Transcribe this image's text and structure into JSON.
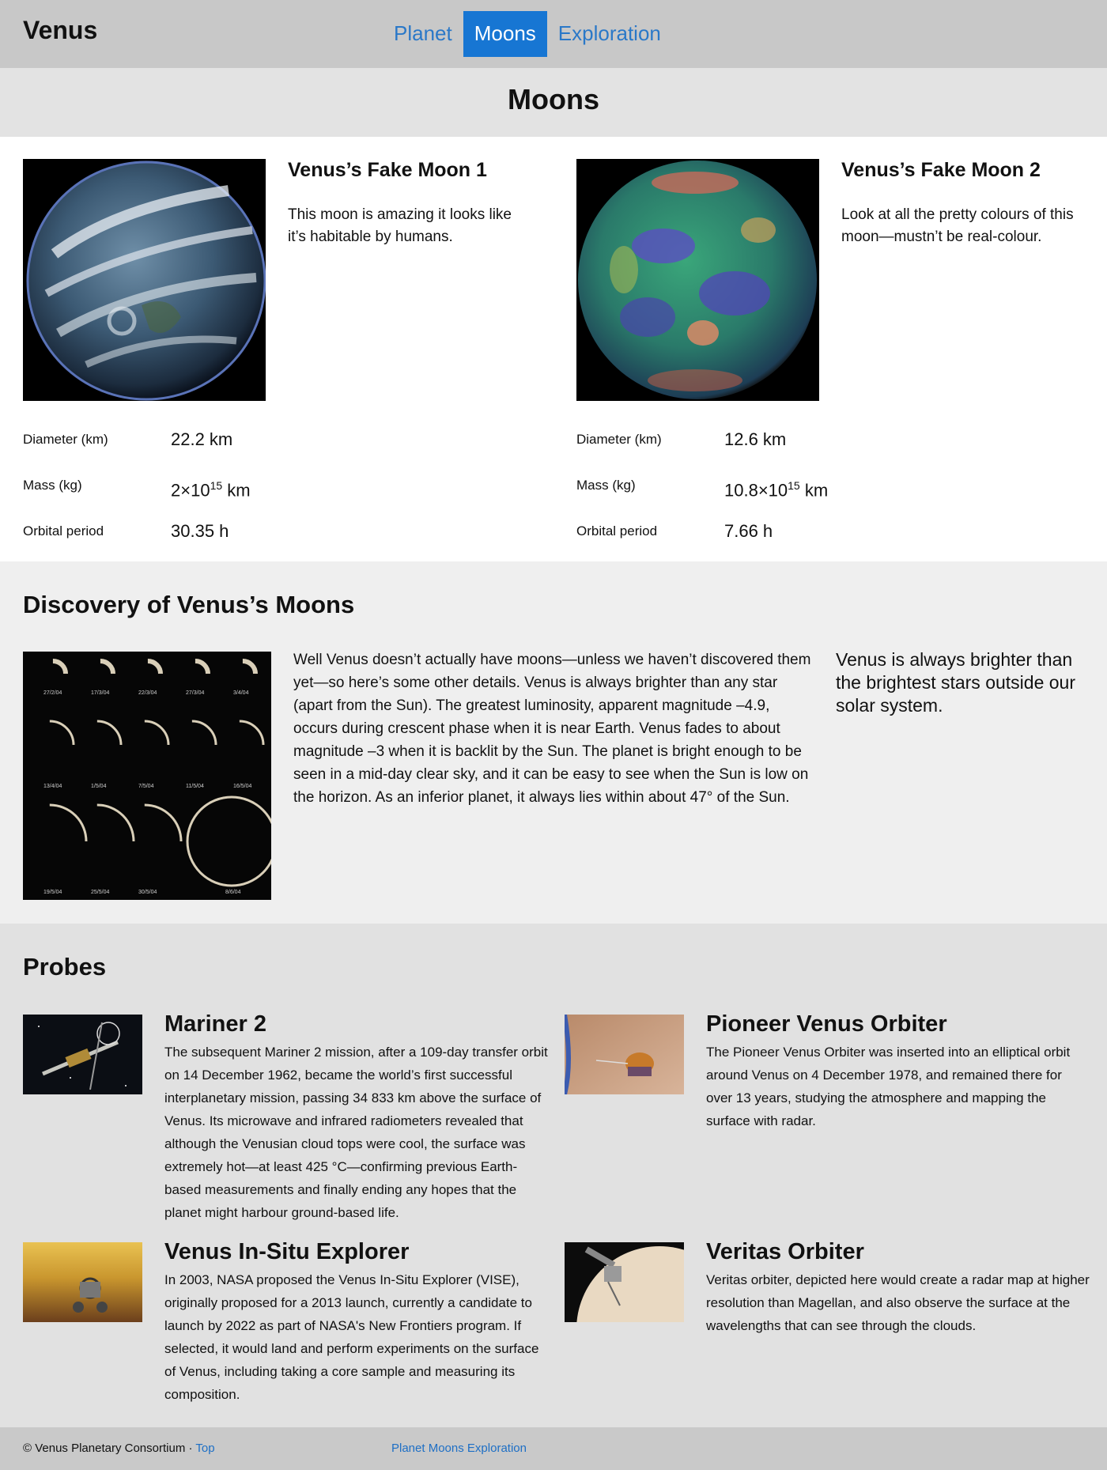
{
  "header": {
    "brand": "Venus",
    "nav": [
      {
        "label": "Planet",
        "active": false
      },
      {
        "label": "Moons",
        "active": true
      },
      {
        "label": "Exploration",
        "active": false
      }
    ]
  },
  "page_title": "Moons",
  "moons": [
    {
      "name": "Venus’s Fake Moon 1",
      "description": "This moon is amazing it looks like it’s habitable by humans.",
      "stats": {
        "diameter_label": "Diameter (km)",
        "diameter_value": "22.2 km",
        "mass_label": "Mass (kg)",
        "mass_base": "2×10",
        "mass_exp": "15",
        "mass_unit": " km",
        "period_label": "Orbital period",
        "period_value": "30.35 h"
      }
    },
    {
      "name": "Venus’s Fake Moon 2",
      "description": "Look at all the pretty colours of this moon—mustn’t be real-colour.",
      "stats": {
        "diameter_label": "Diameter (km)",
        "diameter_value": "12.6 km",
        "mass_label": "Mass (kg)",
        "mass_base": "10.8×10",
        "mass_exp": "15",
        "mass_unit": " km",
        "period_label": "Orbital period",
        "period_value": "7.66 h"
      }
    }
  ],
  "discovery": {
    "heading": "Discovery of Venus’s Moons",
    "phase_dates": [
      "27/2/04",
      "17/3/04",
      "22/3/04",
      "27/3/04",
      "3/4/04",
      "13/4/04",
      "1/5/04",
      "7/5/04",
      "11/5/04",
      "16/5/04",
      "19/5/04",
      "25/5/04",
      "30/5/04",
      "8/6/04"
    ],
    "body": "Well Venus doesn’t actually have moons—unless we haven’t discovered them yet—so here’s some other details. Venus is always brighter than any star (apart from the Sun). The greatest luminosity, apparent magnitude –4.9, occurs during crescent phase when it is near Earth. Venus fades to about magnitude –3 when it is backlit by the Sun. The planet is bright enough to be seen in a mid-day clear sky, and it can be easy to see when the Sun is low on the horizon. As an inferior planet, it always lies within about 47° of the Sun.",
    "aside": "Venus is always brighter than the brightest stars outside our solar system."
  },
  "probes": {
    "heading": "Probes",
    "items": [
      {
        "title": "Mariner 2",
        "text": "The subsequent Mariner 2 mission, after a 109-day transfer orbit on 14 December 1962, became the world’s first successful interplanetary mission, passing 34 833 km above the surface of Venus. Its microwave and infrared radiometers revealed that although the Venusian cloud tops were cool, the surface was extremely hot—at least 425 °C—confirming previous Earth-based measurements and finally ending any hopes that the planet might harbour ground-based life."
      },
      {
        "title": "Pioneer Venus Orbiter",
        "text": "The Pioneer Venus Orbiter was inserted into an elliptical orbit around Venus on 4 December 1978, and remained there for over 13 years, studying the atmosphere and mapping the surface with radar."
      },
      {
        "title": "Venus In-Situ Explorer",
        "text": "In 2003, NASA proposed the Venus In-Situ Explorer (VISE), originally proposed for a 2013 launch, currently a candidate to launch by 2022 as part of NASA's New Frontiers program. If selected, it would land and perform experiments on the surface of Venus, including taking a core sample and measuring its composition."
      },
      {
        "title": "Veritas Orbiter",
        "text": "Veritas orbiter, depicted here would create a radar map at higher resolution than Magellan, and also observe the surface at the wavelengths that can see through the clouds."
      }
    ]
  },
  "footer": {
    "copyright": "© Venus Planetary Consortium · ",
    "top_link": "Top",
    "links": [
      "Planet",
      "Moons",
      "Exploration"
    ]
  },
  "colors": {
    "accent": "#1776d3",
    "link": "#2a78c8",
    "header_bg": "#c8c8c8"
  }
}
